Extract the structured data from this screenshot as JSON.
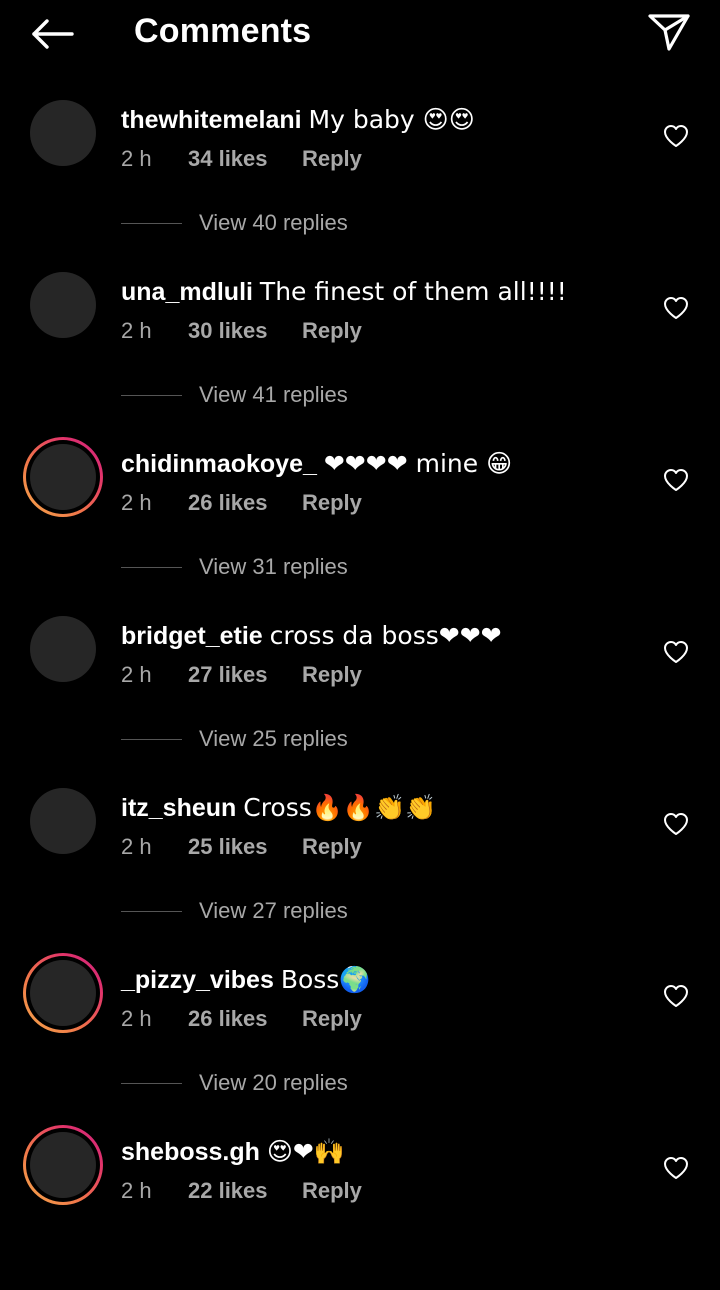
{
  "header": {
    "title": "Comments",
    "back_icon": "arrow-left-icon",
    "share_icon": "paper-plane-icon"
  },
  "comments": [
    {
      "username": "thewhitemelani",
      "text": "My baby 😍😍",
      "time": "2 h",
      "likes": "34 likes",
      "reply": "Reply",
      "view_replies": "View 40 replies",
      "story_ring": false
    },
    {
      "username": "una_mdluli",
      "text": "The finest of them all!!!!",
      "time": "2 h",
      "likes": "30 likes",
      "reply": "Reply",
      "view_replies": "View 41 replies",
      "story_ring": false
    },
    {
      "username": "chidinmaokoye_",
      "text": "❤❤❤❤ mine 😁",
      "time": "2 h",
      "likes": "26 likes",
      "reply": "Reply",
      "view_replies": "View 31 replies",
      "story_ring": true
    },
    {
      "username": "bridget_etie",
      "text": "cross da boss❤❤❤",
      "time": "2 h",
      "likes": "27 likes",
      "reply": "Reply",
      "view_replies": "View 25 replies",
      "story_ring": false
    },
    {
      "username": "itz_sheun",
      "text": "Cross🔥🔥👏👏",
      "time": "2 h",
      "likes": "25 likes",
      "reply": "Reply",
      "view_replies": "View 27 replies",
      "story_ring": false
    },
    {
      "username": "_pizzy_vibes",
      "text": "Boss🌍",
      "time": "2 h",
      "likes": "26 likes",
      "reply": "Reply",
      "view_replies": "View 20 replies",
      "story_ring": true
    },
    {
      "username": "sheboss.gh",
      "text": "😍❤🙌",
      "time": "2 h",
      "likes": "22 likes",
      "reply": "Reply",
      "view_replies": "",
      "story_ring": true
    }
  ],
  "colors": {
    "background": "#000000",
    "primary_text": "#ffffff",
    "secondary_text": "#a8a8a8",
    "avatar_placeholder": "#262626"
  }
}
